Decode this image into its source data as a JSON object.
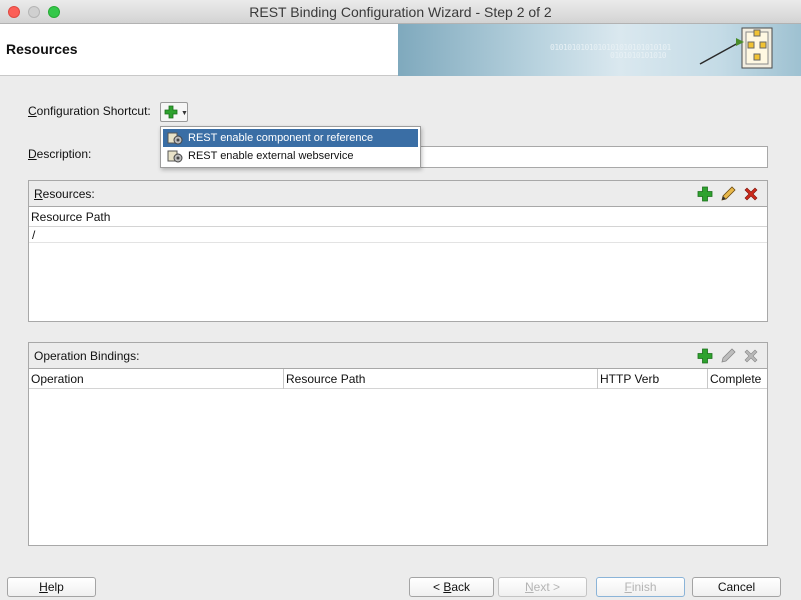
{
  "window": {
    "title": "REST Binding Configuration Wizard - Step 2 of 2"
  },
  "header": {
    "title": "Resources",
    "banner_bits_line1": "0101010101010101010101010101",
    "banner_bits_line2": "0101010101010"
  },
  "config": {
    "shortcut_mnemonic": "C",
    "shortcut_rest": "onfiguration Shortcut:",
    "description_mnemonic": "D",
    "description_rest": "escription:",
    "description_value": ""
  },
  "popup": {
    "items": [
      {
        "label": "REST enable component or reference",
        "icon": "component-gear-icon",
        "selected": true
      },
      {
        "label": "REST enable external webservice",
        "icon": "webservice-gear-icon",
        "selected": false
      }
    ]
  },
  "resources": {
    "title_mnemonic": "R",
    "title_rest": "esources:",
    "columns": [
      "Resource Path"
    ],
    "rows": [
      [
        "/"
      ]
    ]
  },
  "operations": {
    "title": "Operation Bindings:",
    "columns": [
      "Operation",
      "Resource Path",
      "HTTP Verb",
      "Complete"
    ],
    "rows": []
  },
  "buttons": {
    "help_mnemonic": "H",
    "help_rest": "elp",
    "back_prefix": "< ",
    "back_mnemonic": "B",
    "back_rest": "ack",
    "next_mnemonic": "N",
    "next_rest": "ext >",
    "finish_mnemonic": "F",
    "finish_rest": "inish",
    "cancel": "Cancel"
  },
  "colors": {
    "accent_selection": "#3a6ea5",
    "add_green": "#2ea22e",
    "delete_red": "#cc2a1c",
    "edit_orange": "#d99a2b"
  }
}
